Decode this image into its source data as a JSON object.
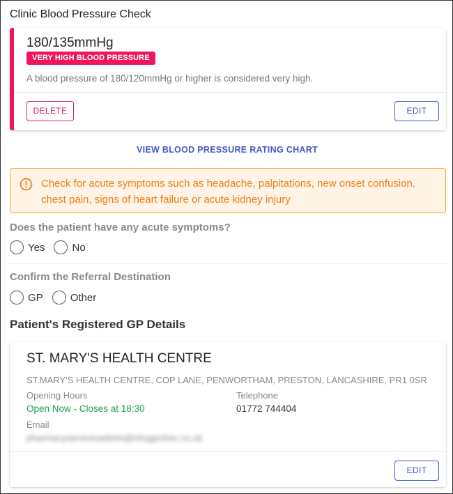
{
  "page": {
    "title": "Clinic Blood Pressure Check"
  },
  "bp": {
    "reading": "180/135mmHg",
    "badge": "VERY HIGH BLOOD PRESSURE",
    "description": "A blood pressure of 180/120mmHg or higher is considered very high.",
    "delete_label": "DELETE",
    "edit_label": "EDIT",
    "accent_color": "#f0145a"
  },
  "chart_link": "VIEW BLOOD PRESSURE RATING CHART",
  "alert": {
    "icon": "warning-circle-icon",
    "text": "Check for acute symptoms such as headache, palpitations, new onset confusion, chest pain, signs of heart failure or acute kidney injury"
  },
  "symptoms": {
    "question": "Does the patient have any acute symptoms?",
    "options": [
      "Yes",
      "No"
    ]
  },
  "referral": {
    "question": "Confirm the Referral Destination",
    "options": [
      "GP",
      "Other"
    ]
  },
  "gp": {
    "heading": "Patient's Registered GP Details",
    "name": "ST. MARY'S HEALTH CENTRE",
    "address": "ST.MARY'S HEALTH CENTRE, COP LANE, PENWORTHAM, PRESTON, LANCASHIRE, PR1 0SR",
    "hours_label": "Opening Hours",
    "hours_value": "Open Now - Closes at 18:30",
    "telephone_label": "Telephone",
    "telephone_value": "01772 744404",
    "email_label": "Email",
    "email_value": "pharmacyservicesadmin@nhsgpclinic.co.uk",
    "edit_label": "EDIT"
  }
}
